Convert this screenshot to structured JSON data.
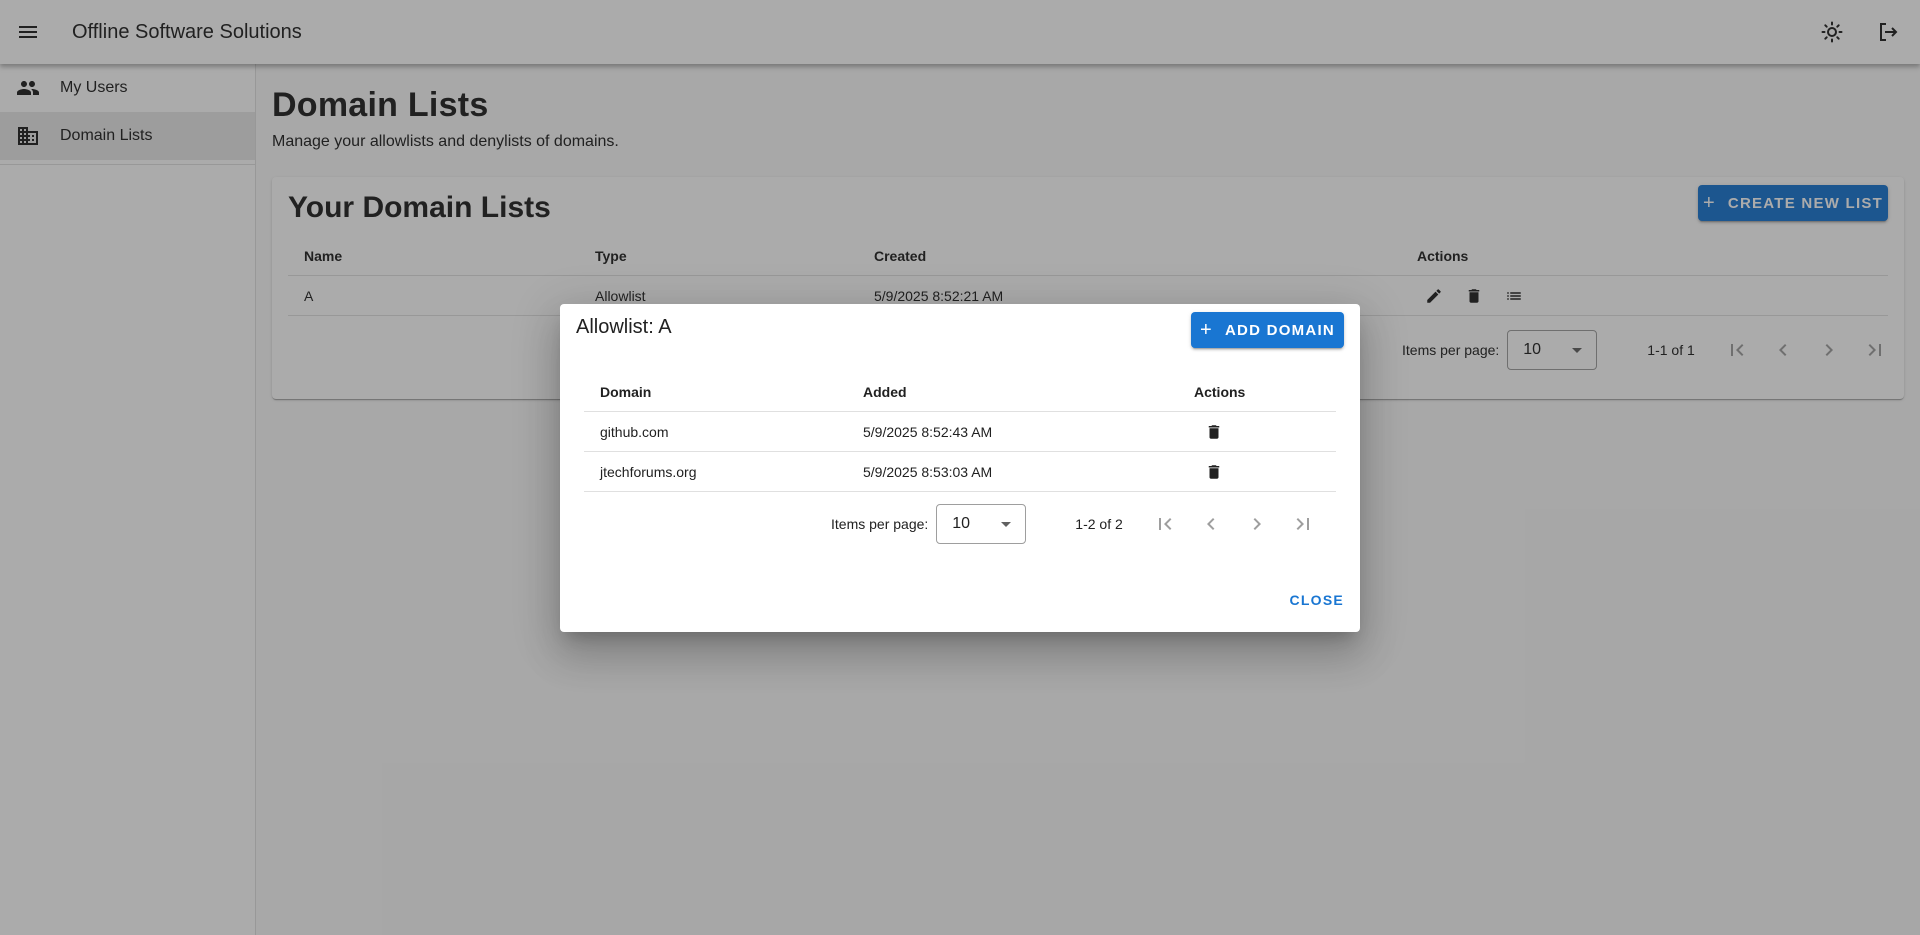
{
  "app": {
    "title": "Offline Software Solutions",
    "icons": {
      "menu": "menu-icon",
      "theme": "brightness-icon",
      "logout": "logout-icon"
    }
  },
  "sidebar": {
    "items": [
      {
        "label": "My Users",
        "icon": "users-icon",
        "active": false
      },
      {
        "label": "Domain Lists",
        "icon": "domain-icon",
        "active": true
      }
    ]
  },
  "page": {
    "title": "Domain Lists",
    "subtitle": "Manage your allowlists and denylists of domains."
  },
  "card": {
    "title": "Your Domain Lists",
    "create_button": "CREATE NEW LIST",
    "columns": [
      "Name",
      "Type",
      "Created",
      "Actions"
    ],
    "rows": [
      {
        "name": "A",
        "type": "Allowlist",
        "created": "5/9/2025 8:52:21 AM",
        "actions": [
          "edit-icon",
          "delete-icon",
          "list-icon"
        ]
      }
    ],
    "pagination": {
      "items_per_page_label": "Items per page:",
      "items_per_page": "10",
      "range": "1-1 of 1"
    }
  },
  "dialog": {
    "title": "Allowlist: A",
    "add_button": "ADD DOMAIN",
    "columns": [
      "Domain",
      "Added",
      "Actions"
    ],
    "rows": [
      {
        "domain": "github.com",
        "added": "5/9/2025 8:52:43 AM"
      },
      {
        "domain": "jtechforums.org",
        "added": "5/9/2025 8:53:03 AM"
      }
    ],
    "pagination": {
      "items_per_page_label": "Items per page:",
      "items_per_page": "10",
      "range": "1-2 of 2"
    },
    "close_button": "CLOSE"
  },
  "colors": {
    "primary": "#1976d2",
    "scrim": "rgba(33,33,33,0.38)"
  }
}
